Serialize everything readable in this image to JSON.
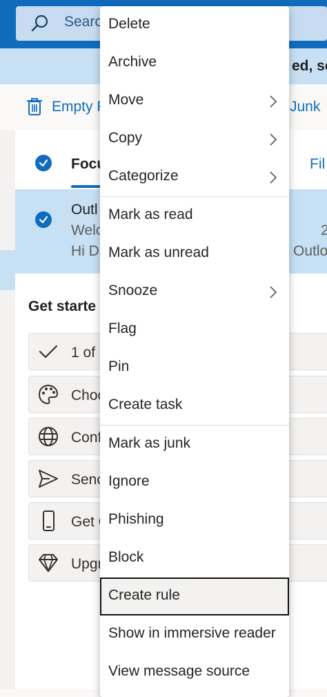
{
  "search": {
    "placeholder": "Search"
  },
  "infobar": {
    "text": "ed, sec"
  },
  "toolbar": {
    "empty_label": "Empty F",
    "junk_label": "Junk"
  },
  "tabs": {
    "focused": "Focu",
    "filter": "Fil"
  },
  "message": {
    "sender": "Outl",
    "subject": "Welc",
    "preview": "Hi Da",
    "time": "2",
    "preview_tail": "Outlo"
  },
  "get_started": {
    "title": "Get starte",
    "items": [
      {
        "icon": "check-icon",
        "label": "1 of"
      },
      {
        "icon": "palette-icon",
        "label": "Choo"
      },
      {
        "icon": "globe-icon",
        "label": "Conf"
      },
      {
        "icon": "send-icon",
        "label": "Senc"
      },
      {
        "icon": "phone-icon",
        "label": "Get C"
      },
      {
        "icon": "diamond-icon",
        "label": "Upgr"
      }
    ]
  },
  "context_menu": {
    "items": [
      {
        "label": "Delete",
        "submenu": false
      },
      {
        "label": "Archive",
        "submenu": false
      },
      {
        "label": "Move",
        "submenu": true
      },
      {
        "label": "Copy",
        "submenu": true
      },
      {
        "label": "Categorize",
        "submenu": true
      },
      {
        "label": "Mark as read",
        "submenu": false
      },
      {
        "label": "Mark as unread",
        "submenu": false
      },
      {
        "label": "Snooze",
        "submenu": true
      },
      {
        "label": "Flag",
        "submenu": false
      },
      {
        "label": "Pin",
        "submenu": false
      },
      {
        "label": "Create task",
        "submenu": false
      },
      {
        "label": "Mark as junk",
        "submenu": false
      },
      {
        "label": "Ignore",
        "submenu": false
      },
      {
        "label": "Phishing",
        "submenu": false
      },
      {
        "label": "Block",
        "submenu": false
      },
      {
        "label": "Create rule",
        "submenu": false,
        "selected": true
      },
      {
        "label": "Show in immersive reader",
        "submenu": false
      },
      {
        "label": "View message source",
        "submenu": false
      }
    ]
  },
  "colors": {
    "brand": "#0f6cbd",
    "selection": "#c7e0f4",
    "search_bg": "#c7dcf1"
  }
}
